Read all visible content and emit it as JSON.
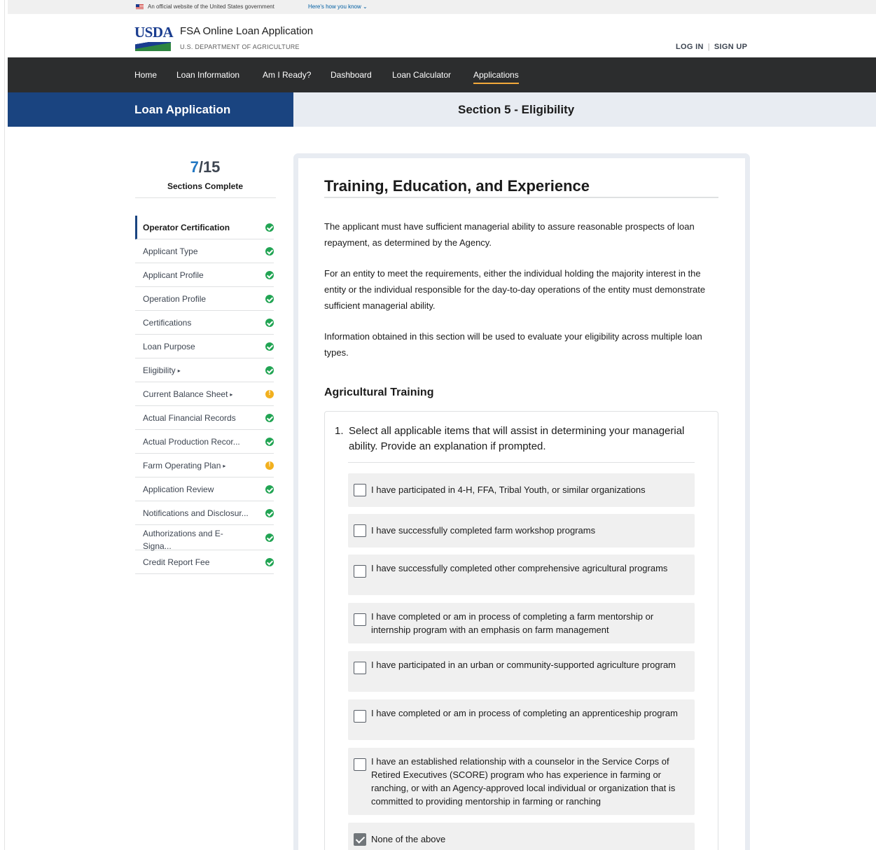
{
  "gov_banner": {
    "official_text": "An official website of the United States government",
    "how_know_link": "Here's how you know ⌄"
  },
  "header": {
    "logo_text": "USDA",
    "app_title": "FSA Online Loan Application",
    "department": "U.S. DEPARTMENT OF AGRICULTURE",
    "login": "LOG IN",
    "separator": "|",
    "signup": "SIGN UP"
  },
  "nav": {
    "items": [
      {
        "label": "Home"
      },
      {
        "label": "Loan Information"
      },
      {
        "label": "Am I Ready?"
      },
      {
        "label": "Dashboard"
      },
      {
        "label": "Loan Calculator"
      },
      {
        "label": "Applications",
        "active": true
      }
    ]
  },
  "titlebar": {
    "left": "Loan Application",
    "right": "Section 5 - Eligibility"
  },
  "progress": {
    "completed": "7",
    "total": "/15",
    "label": "Sections Complete"
  },
  "sections": [
    {
      "label": "Operator Certification",
      "status": "complete",
      "current": true
    },
    {
      "label": "Applicant Type",
      "status": "complete"
    },
    {
      "label": "Applicant Profile",
      "status": "complete"
    },
    {
      "label": "Operation Profile",
      "status": "complete"
    },
    {
      "label": "Certifications",
      "status": "complete"
    },
    {
      "label": "Loan Purpose",
      "status": "complete"
    },
    {
      "label": "Eligibility",
      "status": "complete",
      "caret": "▸"
    },
    {
      "label": "Current Balance Sheet",
      "status": "warning",
      "caret": "▸"
    },
    {
      "label": "Actual Financial Records",
      "status": "complete"
    },
    {
      "label": "Actual Production Recor...",
      "status": "complete"
    },
    {
      "label": "Farm Operating Plan",
      "status": "warning",
      "caret": "▸"
    },
    {
      "label": "Application Review",
      "status": "complete"
    },
    {
      "label": "Notifications and Disclosur...",
      "status": "complete"
    },
    {
      "label": "Authorizations and E-Signa...",
      "status": "complete",
      "two_line": true
    },
    {
      "label": "Credit Report Fee",
      "status": "complete"
    }
  ],
  "main": {
    "title": "Training, Education, and Experience",
    "paragraphs": [
      "The applicant must have sufficient managerial ability to assure reasonable prospects of loan repayment, as determined by the Agency.",
      "For an entity to meet the requirements, either the individual holding the majority interest in the entity or the individual responsible for the day-to-day operations of the entity must demonstrate sufficient managerial ability.",
      "Information obtained in this section will be used to evaluate your eligibility across multiple loan types."
    ],
    "subheading": "Agricultural Training",
    "question_number": "1.",
    "question_text": "Select all applicable items that will assist in determining your managerial ability. Provide an explanation if prompted.",
    "options": [
      {
        "label": "I have participated in 4-H, FFA, Tribal Youth, or similar organizations",
        "checked": false
      },
      {
        "label": "I have successfully completed farm workshop programs",
        "checked": false
      },
      {
        "label": "I have successfully completed other comprehensive agricultural programs",
        "checked": false
      },
      {
        "label": "I have completed or am in process of completing a farm mentorship or internship program with an emphasis on farm management",
        "checked": false
      },
      {
        "label": "I have participated in an urban or community-supported agriculture program",
        "checked": false
      },
      {
        "label": "I have completed or am in process of completing an apprenticeship program",
        "checked": false
      },
      {
        "label": "I have an established relationship with a counselor in the Service Corps of Retired Executives (SCORE) program who has experience in farming or ranching, or with an Agency-approved local individual or organization that is committed to providing mentorship in farming or ranching",
        "checked": false
      },
      {
        "label": "None of the above",
        "checked": true
      }
    ]
  },
  "colors": {
    "primary_dark": "#1a4480",
    "nav_bg": "#2c2d2e",
    "nav_active_underline": "#f2a93b",
    "status_complete": "#21a453",
    "status_warning": "#f2b01e",
    "progress_accent": "#2378c3"
  },
  "icons": {
    "cursor": "hand-pointer-icon",
    "complete": "check-circle-icon",
    "warning": "exclamation-circle-icon",
    "caret": "caret-right-icon",
    "flag": "us-flag-icon"
  }
}
